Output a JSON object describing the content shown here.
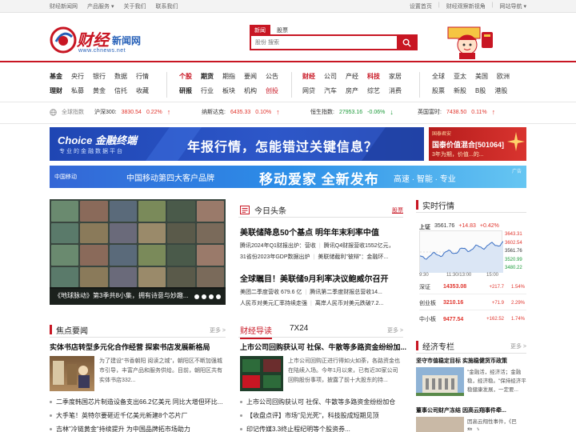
{
  "topbar": {
    "left": [
      "财经新闻网",
      "产品服务 ▾",
      "关于我们",
      "联系我们"
    ],
    "right": [
      "设置首页",
      "财经观察新视角",
      "网站导航 ▾"
    ]
  },
  "logo": {
    "brand": "财经",
    "suffix": "新闻网",
    "url": "www.chnews.net"
  },
  "search": {
    "tabs": [
      "新闻",
      "股票"
    ],
    "placeholder": "股份 搜索"
  },
  "colors": {
    "accent": "#c81623",
    "up": "#e0342c",
    "down": "#1c9a3a"
  },
  "nav": {
    "groups": [
      [
        [
          "基金",
          "央行",
          "银行",
          "数据",
          "行情"
        ],
        [
          "理财",
          "私募",
          "黄金",
          "信托",
          "收藏"
        ]
      ],
      [
        [
          "个股",
          "期货",
          "期指",
          "要闻",
          "公告"
        ],
        [
          "研报",
          "行业",
          "板块",
          "机构",
          "创投"
        ]
      ],
      [
        [
          "财经",
          "公司",
          "产经",
          "科技",
          "家居"
        ],
        [
          "网贷",
          "汽车",
          "房产",
          "综艺",
          "消费"
        ]
      ],
      [
        [
          "全球",
          "亚太",
          "美国",
          "欧洲"
        ],
        [
          "股票",
          "新股",
          "B股",
          "港股"
        ]
      ]
    ]
  },
  "indices": {
    "label": "全球指数",
    "items": [
      {
        "name": "沪深300:",
        "value": "3830.54",
        "change": "0.22%",
        "dir": "up"
      },
      {
        "name": "纳斯达克:",
        "value": "6435.33",
        "change": "0.10%",
        "dir": "up"
      },
      {
        "name": "恒生指数:",
        "value": "27953.16",
        "change": "-0.06%",
        "dir": "down"
      },
      {
        "name": "英国富时:",
        "value": "7438.50",
        "change": "0.11%",
        "dir": "up"
      }
    ]
  },
  "banners": {
    "b1": {
      "brand": "Choice 金融终端",
      "tagline": "专业的金融数据平台",
      "slogan": "年报行情，怎能错过关键信息？"
    },
    "b2": {
      "top": "国泰君安",
      "line1": "国泰价值混合[501064]",
      "line2": "3年为期，价值...的..."
    },
    "b3": {
      "brand": "中国移动",
      "title": "中国移动第四大客户品牌",
      "big": "移动爱家 全新发布",
      "sub": "高速 · 智能 · 专业",
      "tag": "广告"
    }
  },
  "hero": {
    "caption": "《地球脉动》第3季共8小集，拥有诗意与妙趣..."
  },
  "today": {
    "title": "今日头条",
    "more": "股票",
    "items": [
      {
        "headline": "美联储降息50个基点 明年年末利率中值",
        "subs": [
          [
            "腾讯2024年Q1财报出炉：营收",
            "腾讯Q4财报营收1552亿元，"
          ],
          [
            "31省份2023年GDP数据出炉",
            "美联储截利\"彼辩\"：金融环..."
          ]
        ]
      },
      {
        "headline": "全球瞩目！美联储9月利率决议鲍威尔召开",
        "subs": [
          [
            "美团二季度营收 679.6 亿",
            "腾讯第二季度财报总营收14..."
          ],
          [
            "人民币对美元汇率持续走强",
            "离岸人民币对美元跌破7.2..."
          ]
        ]
      }
    ]
  },
  "market": {
    "title": "实时行情",
    "quote": {
      "name": "上证",
      "value": "3561.76",
      "change": "+14.83",
      "pct": "+0.42%"
    },
    "axis_right": [
      "3643.31",
      "3602.54",
      "3561.76",
      "3520.99",
      "3480.22"
    ],
    "axis_x": [
      "9:30",
      "11:30/13:00",
      "15:00"
    ],
    "rows": [
      {
        "name": "深证",
        "value": "14353.08",
        "change": "+217.7",
        "pct": "1.54%"
      },
      {
        "name": "创业板",
        "value": "3210.16",
        "change": "+71.9",
        "pct": "2.29%"
      },
      {
        "name": "中小板",
        "value": "9477.54",
        "change": "+162.52",
        "pct": "1.74%"
      }
    ]
  },
  "focus": {
    "title": "焦点要闻",
    "more": "更多 >",
    "lead": "实体书店转型多元化合作经营 探索书店发展新格局",
    "para": "为了建设\"书香朝阳 阅读之城\"，朝阳区不断加强城市引导，丰富产品和服务供给。目前，朝阳区共有实体书店332...",
    "list": [
      "二季度韩国芯片制造设备支出66.2亿美元 同比大增但环比...",
      "大手笔！英特尔要砸近千亿美元新建8个芯片厂",
      "吉林\"冷链黄金\"持续提升 为中国品牌拓市场助力"
    ]
  },
  "guide": {
    "tabs": [
      "财经导读",
      "7X24"
    ],
    "more": "更多 >",
    "lead": "上市公司回购获认可 社保、牛散等多路资金纷纷加...",
    "para": "上市公司回购正进行得如火如荼，各路资金也在陆续入场。今年1月以来，已有近30家公司回购股份事项，披露了前十大股东的持...",
    "list": [
      "上市公司回购获认可 社保、牛散等多路资金纷纷加仓",
      "【收盘点评】市场\"见光死\"，科技股成短期见顶",
      "印记传媒3.3终止程纪明等个股资券..."
    ]
  },
  "column": {
    "title": "经济专栏",
    "more": "更多 >",
    "items": [
      {
        "head": "坚守市值稳定目标 实施稳健货币政策",
        "text": "\"金融活，经济活；金融稳，经济稳。\"保持经济平稳健康发展，一定要..."
      },
      {
        "head": "董事公司财产冻结 因高云翔事件牵...",
        "text": "因高云翔性事件，《巴黎...》..."
      }
    ]
  }
}
